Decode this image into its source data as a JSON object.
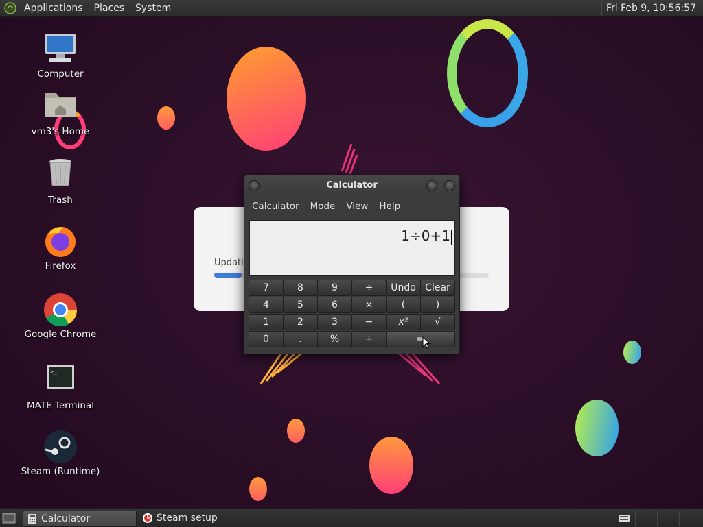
{
  "top_panel": {
    "menus": [
      "Applications",
      "Places",
      "System"
    ],
    "clock": "Fri Feb  9, 10:56:57"
  },
  "desktop_icons": [
    {
      "label": "Computer",
      "icon": "computer-icon"
    },
    {
      "label": "vm3's Home",
      "icon": "home-folder-icon"
    },
    {
      "label": "Trash",
      "icon": "trash-icon"
    },
    {
      "label": "Firefox",
      "icon": "firefox-icon"
    },
    {
      "label": "Google Chrome",
      "icon": "chrome-icon"
    },
    {
      "label": "MATE Terminal",
      "icon": "terminal-icon"
    },
    {
      "label": "Steam (Runtime)",
      "icon": "steam-icon"
    }
  ],
  "update_dialog": {
    "text": "Updatin",
    "progress": 0.1
  },
  "calculator": {
    "title": "Calculator",
    "menus": [
      "Calculator",
      "Mode",
      "View",
      "Help"
    ],
    "display": "1÷0+1",
    "keys": [
      [
        "7",
        "8",
        "9",
        "÷",
        "Undo",
        "Clear"
      ],
      [
        "4",
        "5",
        "6",
        "×",
        "(",
        ")"
      ],
      [
        "1",
        "2",
        "3",
        "−",
        "x²",
        "√"
      ],
      [
        "0",
        ".",
        "%",
        "+",
        "="
      ]
    ]
  },
  "taskbar": {
    "tasks": [
      {
        "label": "Calculator",
        "active": true
      },
      {
        "label": "Steam setup",
        "active": false
      }
    ]
  },
  "colors": {
    "progress": "#3c7ddb",
    "wallpaper": "#2a0e26"
  }
}
